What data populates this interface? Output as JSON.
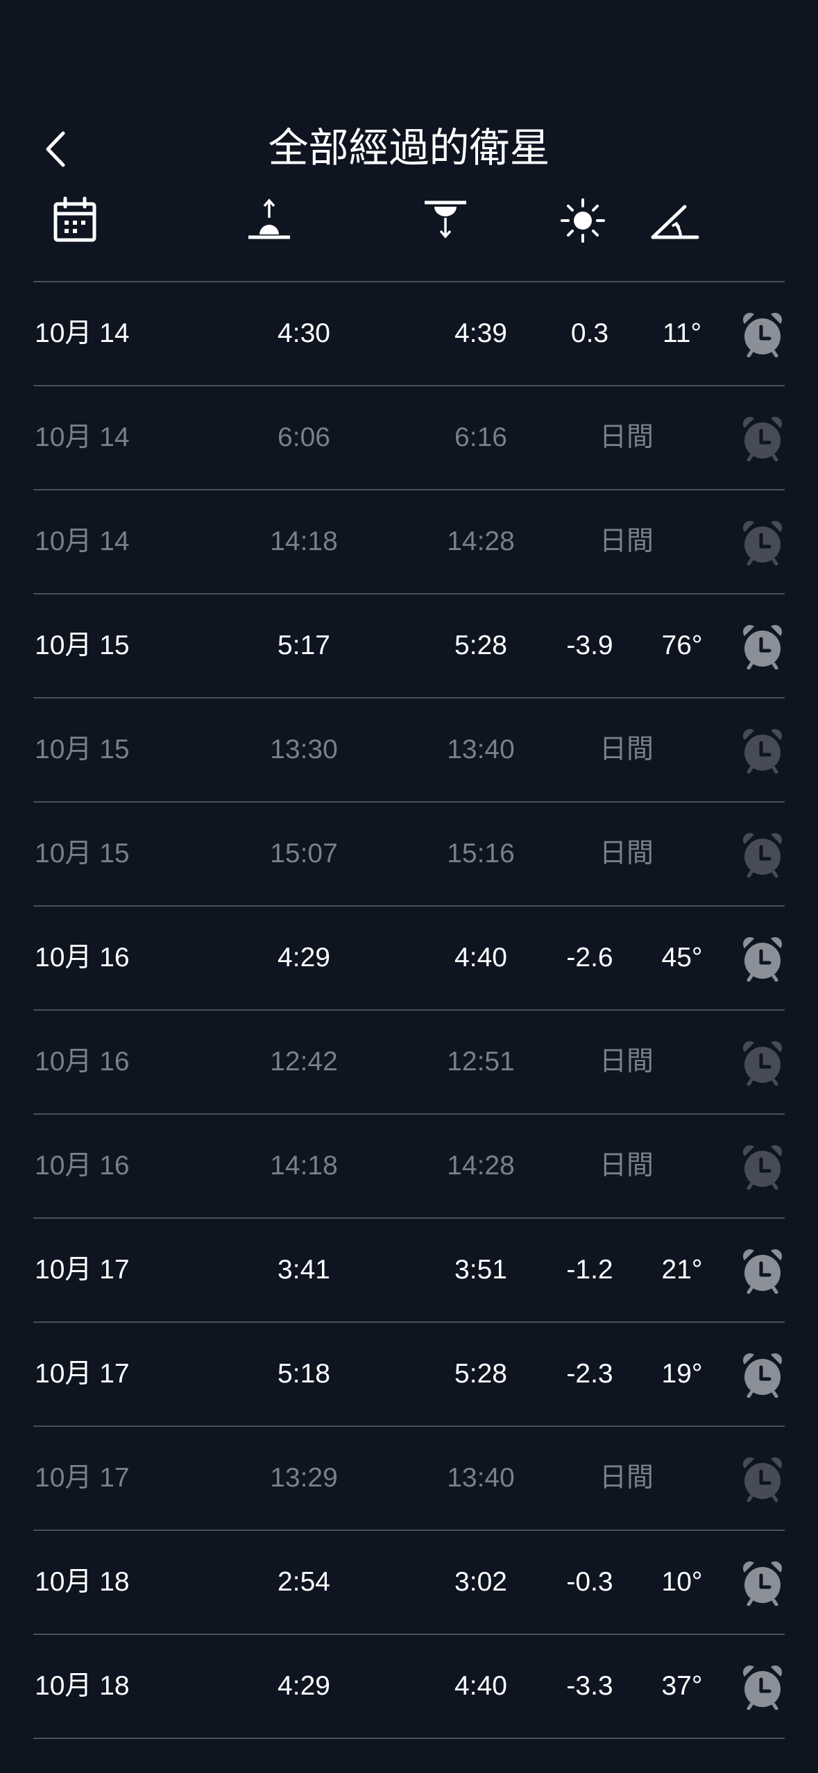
{
  "header": {
    "title": "全部經過的衛星",
    "back_icon": "chevron-left-icon"
  },
  "columns": {
    "date_icon": "calendar-icon",
    "rise_icon": "rise-icon",
    "set_icon": "set-icon",
    "magnitude_icon": "brightness-icon",
    "altitude_icon": "altitude-angle-icon"
  },
  "colors": {
    "background": "#0e1420",
    "bright_text": "#ffffff",
    "dim_text": "#7a7f89",
    "divider": "#4a505c",
    "alarm_icon": "#8a8f98"
  },
  "passes": [
    {
      "date": "10月 14",
      "rise": "4:30",
      "set": "4:39",
      "magnitude": "0.3",
      "altitude": "11°",
      "visible": true
    },
    {
      "date": "10月 14",
      "rise": "6:06",
      "set": "6:16",
      "daytime": "日間",
      "visible": false
    },
    {
      "date": "10月 14",
      "rise": "14:18",
      "set": "14:28",
      "daytime": "日間",
      "visible": false
    },
    {
      "date": "10月 15",
      "rise": "5:17",
      "set": "5:28",
      "magnitude": "-3.9",
      "altitude": "76°",
      "visible": true
    },
    {
      "date": "10月 15",
      "rise": "13:30",
      "set": "13:40",
      "daytime": "日間",
      "visible": false
    },
    {
      "date": "10月 15",
      "rise": "15:07",
      "set": "15:16",
      "daytime": "日間",
      "visible": false
    },
    {
      "date": "10月 16",
      "rise": "4:29",
      "set": "4:40",
      "magnitude": "-2.6",
      "altitude": "45°",
      "visible": true
    },
    {
      "date": "10月 16",
      "rise": "12:42",
      "set": "12:51",
      "daytime": "日間",
      "visible": false
    },
    {
      "date": "10月 16",
      "rise": "14:18",
      "set": "14:28",
      "daytime": "日間",
      "visible": false
    },
    {
      "date": "10月 17",
      "rise": "3:41",
      "set": "3:51",
      "magnitude": "-1.2",
      "altitude": "21°",
      "visible": true
    },
    {
      "date": "10月 17",
      "rise": "5:18",
      "set": "5:28",
      "magnitude": "-2.3",
      "altitude": "19°",
      "visible": true
    },
    {
      "date": "10月 17",
      "rise": "13:29",
      "set": "13:40",
      "daytime": "日間",
      "visible": false
    },
    {
      "date": "10月 18",
      "rise": "2:54",
      "set": "3:02",
      "magnitude": "-0.3",
      "altitude": "10°",
      "visible": true
    },
    {
      "date": "10月 18",
      "rise": "4:29",
      "set": "4:40",
      "magnitude": "-3.3",
      "altitude": "37°",
      "visible": true
    }
  ]
}
